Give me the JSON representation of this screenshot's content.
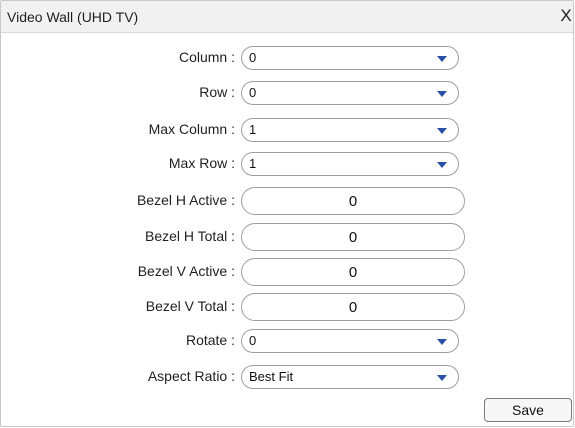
{
  "dialog": {
    "title": "Video Wall (UHD TV)",
    "close_label": "X"
  },
  "fields": {
    "column": {
      "label": "Column :",
      "value": "0"
    },
    "row": {
      "label": "Row :",
      "value": "0"
    },
    "max_column": {
      "label": "Max Column :",
      "value": "1"
    },
    "max_row": {
      "label": "Max Row :",
      "value": "1"
    },
    "bezel_h_active": {
      "label": "Bezel H Active :",
      "value": "0"
    },
    "bezel_h_total": {
      "label": "Bezel H Total :",
      "value": "0"
    },
    "bezel_v_active": {
      "label": "Bezel V Active :",
      "value": "0"
    },
    "bezel_v_total": {
      "label": "Bezel V Total :",
      "value": "0"
    },
    "rotate": {
      "label": "Rotate :",
      "value": "0"
    },
    "aspect_ratio": {
      "label": "Aspect Ratio :",
      "value": "Best Fit"
    }
  },
  "actions": {
    "save_label": "Save"
  },
  "icons": {
    "dropdown": "chevron-down-icon",
    "close": "close-icon"
  },
  "colors": {
    "dropdown_arrow": "#2a4fa8",
    "titlebar_bg": "#f1f1f1"
  }
}
